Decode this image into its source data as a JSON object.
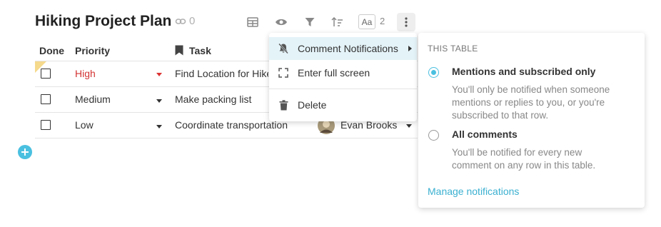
{
  "doc": {
    "title": "Hiking Project Plan",
    "link_count": "0"
  },
  "toolbar": {
    "font_label": "Aa",
    "font_count": "2"
  },
  "table": {
    "columns": {
      "done": "Done",
      "priority": "Priority",
      "task": "Task"
    },
    "rows": [
      {
        "priority": "High",
        "task": "Find Location for Hike",
        "assignee": ""
      },
      {
        "priority": "Medium",
        "task": "Make packing list",
        "assignee": ""
      },
      {
        "priority": "Low",
        "task": "Coordinate transportation",
        "assignee": "Evan Brooks"
      }
    ]
  },
  "menu": {
    "items": [
      {
        "label": "Comment Notifications",
        "icon": "bell-off-icon"
      },
      {
        "label": "Enter full screen",
        "icon": "fullscreen-icon"
      },
      {
        "label": "Delete",
        "icon": "trash-icon"
      }
    ]
  },
  "notifications": {
    "section_label": "THIS TABLE",
    "options": [
      {
        "title": "Mentions and subscribed only",
        "lines": [
          "You'll only be notified when someone",
          "mentions or replies to you, or you're",
          "subscribed to that row."
        ],
        "selected": true
      },
      {
        "title": "All comments",
        "lines": [
          "You'll be notified for every new",
          "comment on any row in this table."
        ],
        "selected": false
      }
    ],
    "manage_link": "Manage notifications"
  },
  "colors": {
    "accent": "#4ac0e0",
    "link": "#3ab0d0",
    "high_priority": "#d33333",
    "menu_active": "#e4f3f8"
  }
}
